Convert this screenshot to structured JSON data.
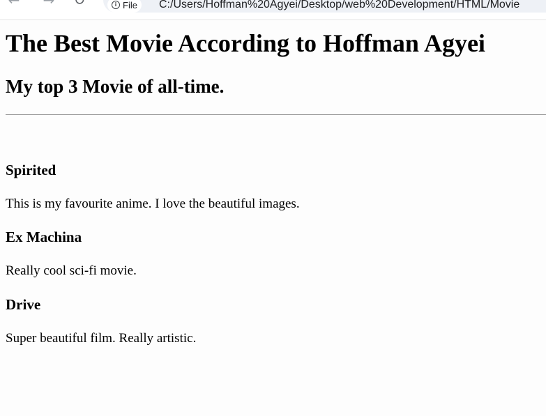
{
  "browser": {
    "back_icon": "arrow-left-icon",
    "forward_icon": "arrow-right-icon",
    "reload_icon": "reload-icon",
    "site_info_label": "File",
    "url": "C:/Users/Hoffman%20Agyei/Desktop/web%20Development/HTML/Movie"
  },
  "page": {
    "title": "The Best Movie According to Hoffman Agyei",
    "subtitle": "My top 3 Movie of all-time.",
    "movies": [
      {
        "name": "Spirited",
        "description": "This is my favourite anime. I love the beautiful images."
      },
      {
        "name": "Ex Machina",
        "description": "Really cool sci-fi movie."
      },
      {
        "name": "Drive",
        "description": "Super beautiful film. Really artistic."
      }
    ]
  }
}
